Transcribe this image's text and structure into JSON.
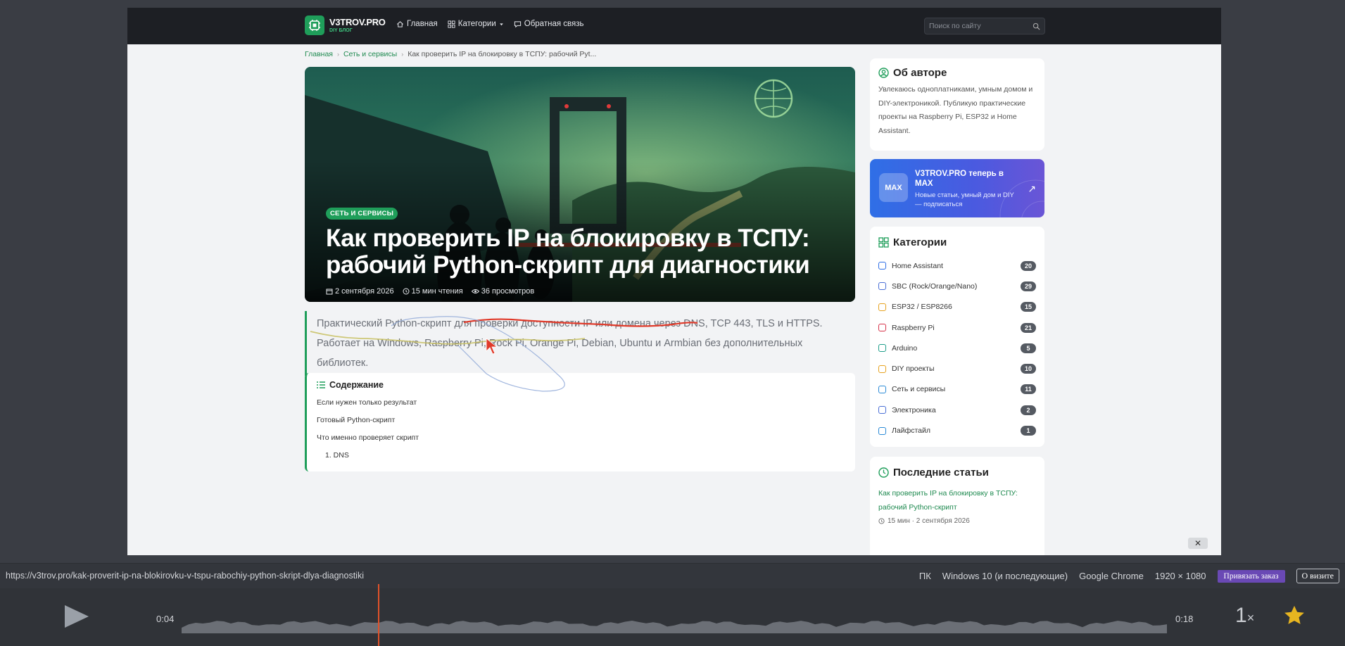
{
  "site": {
    "logo_title": "V3TROV.PRO",
    "logo_sub": "DIY БЛОГ",
    "nav": [
      {
        "label": "Главная"
      },
      {
        "label": "Категории"
      },
      {
        "label": "Обратная связь"
      }
    ],
    "search_placeholder": "Поиск по сайту"
  },
  "breadcrumb": {
    "home": "Главная",
    "section": "Сеть и сервисы",
    "current": "Как проверить IP на блокировку в ТСПУ: рабочий Pyt..."
  },
  "hero": {
    "badge": "СЕТЬ И СЕРВИСЫ",
    "title_line1": "Как проверить IP на блокировку в ТСПУ:",
    "title_line2": "рабочий Python-скрипт для диагностики",
    "date": "2 сентября 2026",
    "read_time": "15 мин чтения",
    "views": "36 просмотров"
  },
  "lead": {
    "line1": "Практический Python-скрипт для проверки доступности IP или домена через DNS, TCP 443, TLS и HTTPS.",
    "line2": "Работает на Windows, Raspberry Pi, Rock Pi, Orange Pi, Debian, Ubuntu и Armbian без дополнительных",
    "line3": "библиотек."
  },
  "toc": {
    "title": "Содержание",
    "items": [
      "Если нужен только результат",
      "Готовый Python-скрипт",
      "Что именно проверяет скрипт",
      "1. DNS"
    ]
  },
  "sidebar": {
    "about_title": "Об авторе",
    "about_text": "Увлекаюсь одноплатниками, умным домом и DIY-электроникой. Публикую практические проекты на Raspberry Pi, ESP32 и Home Assistant.",
    "max_logo": "MAX",
    "max_title": "V3TROV.PRO теперь в MAX",
    "max_sub": "Новые статьи, умный дом и DIY — подписаться",
    "categories_title": "Категории",
    "categories": [
      {
        "label": "Home Assistant",
        "count": "20",
        "color": "#2f6fe6"
      },
      {
        "label": "SBC (Rock/Orange/Nano)",
        "count": "29",
        "color": "#4a6fd6"
      },
      {
        "label": "ESP32 / ESP8266",
        "count": "15",
        "color": "#e6a21f"
      },
      {
        "label": "Raspberry Pi",
        "count": "21",
        "color": "#d6334a"
      },
      {
        "label": "Arduino",
        "count": "5",
        "color": "#1f9e8a"
      },
      {
        "label": "DIY проекты",
        "count": "10",
        "color": "#e6a21f"
      },
      {
        "label": "Сеть и сервисы",
        "count": "11",
        "color": "#2a8ad6"
      },
      {
        "label": "Электроника",
        "count": "2",
        "color": "#4a6fd6"
      },
      {
        "label": "Лайфстайл",
        "count": "1",
        "color": "#2a8ad6"
      }
    ],
    "recent_title": "Последние статьи",
    "recent_link": "Как проверить IP на блокировку в ТСПУ: рабочий Python-скрипт",
    "recent_meta": "15 мин · 2 сентября 2026"
  },
  "player": {
    "url": "https://v3trov.pro/kak-proverit-ip-na-blokirovku-v-tspu-rabochiy-python-skript-dlya-diagnostiki",
    "device": "ПК",
    "os": "Windows 10 (и последующие)",
    "browser": "Google Chrome",
    "resolution": "1920 × 1080",
    "bind_button": "Привязать заказ",
    "visit_button": "О визите",
    "time_current": "0:04",
    "time_total": "0:18",
    "speed": "1",
    "speed_suffix": "×",
    "progress": 0.2,
    "close_label": "✕"
  },
  "colors": {
    "accent": "#1f9e5a",
    "player_marker": "#e0522a",
    "star": "#e7b520"
  }
}
